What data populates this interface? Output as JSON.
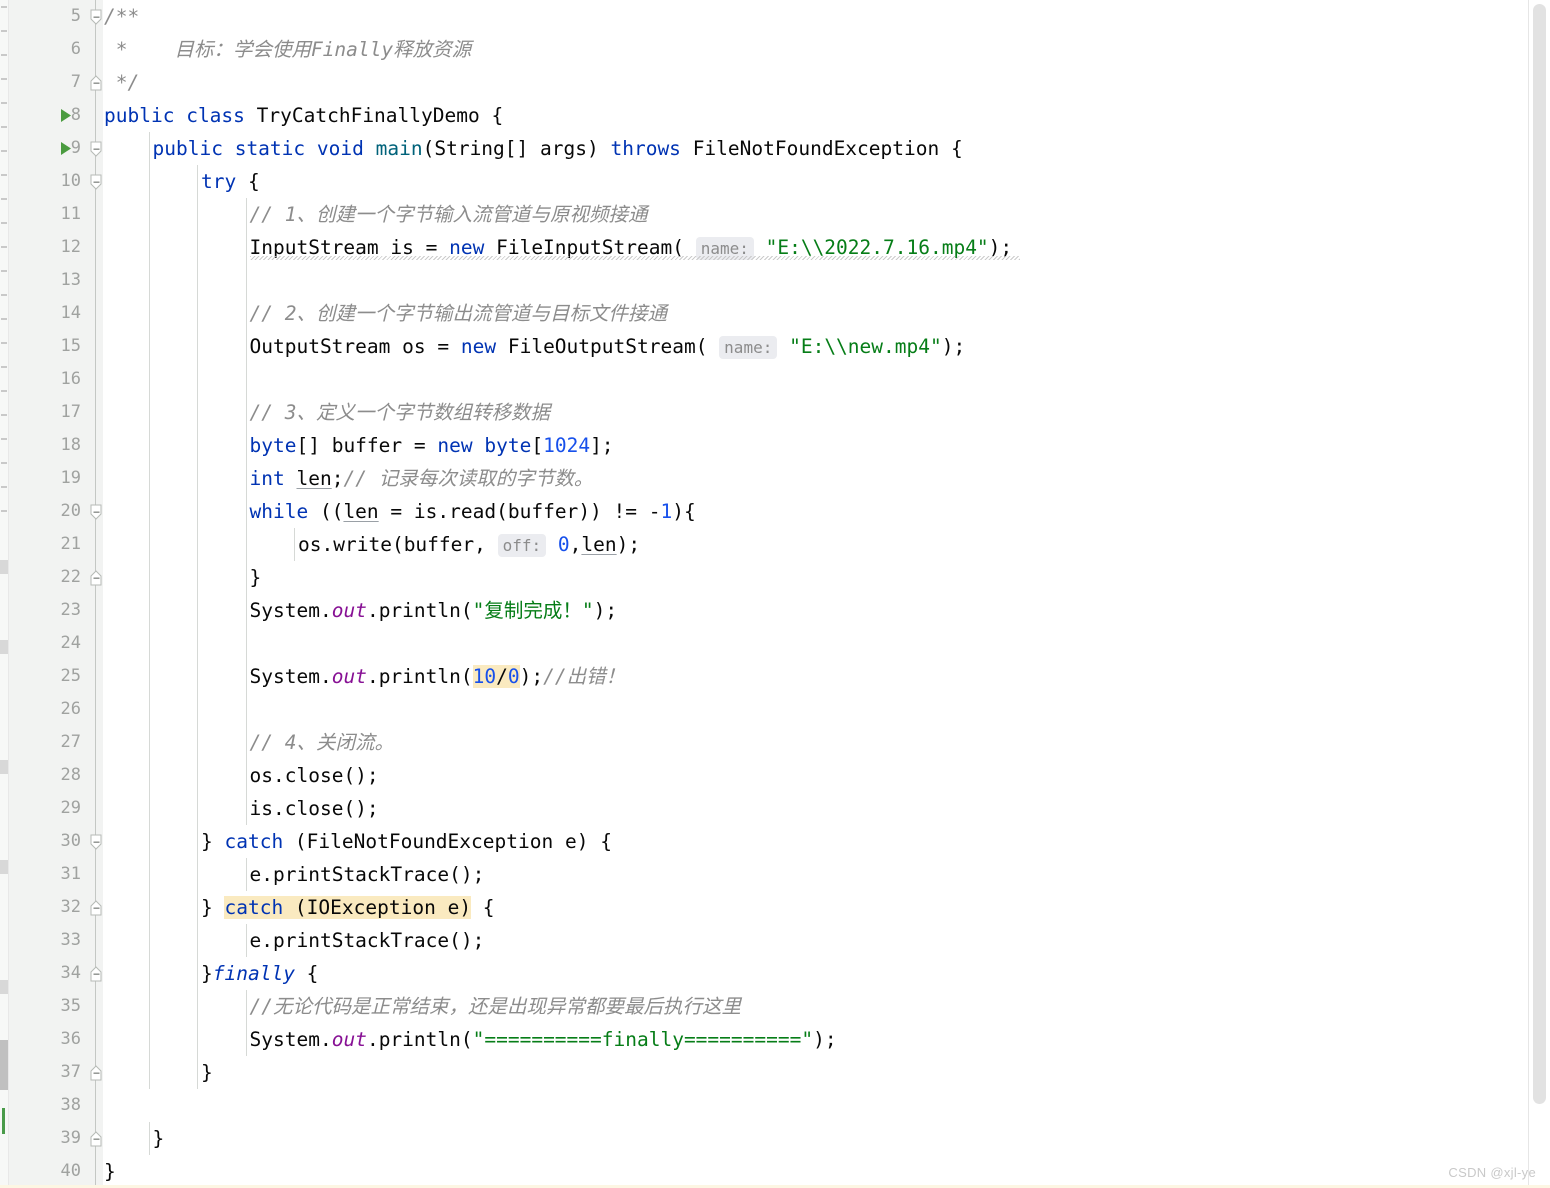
{
  "editor": {
    "app": "IntelliJ IDEA Java Editor",
    "language": "java",
    "watermark": "CSDN @xjl-ye",
    "colors": {
      "background": "#ffffff",
      "gutter_background": "#f2f3f2",
      "line_number": "#a0a2a0",
      "keyword": "#0033b3",
      "string": "#067d17",
      "comment": "#8c8c8c",
      "number": "#1750eb",
      "method": "#00627a",
      "static_field": "#871094",
      "highlight": "#faeac0",
      "hint_chip": "#ebecf0",
      "run_arrow": "#4a9b3f"
    },
    "first_line_number": 5,
    "last_line_number": 40
  },
  "gutter": {
    "line_numbers": [
      5,
      6,
      7,
      8,
      9,
      10,
      11,
      12,
      13,
      14,
      15,
      16,
      17,
      18,
      19,
      20,
      21,
      22,
      23,
      24,
      25,
      26,
      27,
      28,
      29,
      30,
      31,
      32,
      33,
      34,
      35,
      36,
      37,
      38,
      39,
      40
    ],
    "run_arrow_lines": [
      8,
      9
    ],
    "fold_lines": [
      5,
      7,
      9,
      10,
      20,
      22,
      30,
      32,
      34,
      37,
      39
    ],
    "fold_open_lines": [
      5,
      9,
      10,
      20,
      30
    ],
    "fold_close_lines": [
      7,
      22,
      32,
      34,
      37,
      39
    ]
  },
  "code": {
    "lines": [
      {
        "n": 5,
        "indent": 0,
        "text": "/**"
      },
      {
        "n": 6,
        "indent": 0,
        "text": " *    目标：学会使用Finally释放资源"
      },
      {
        "n": 7,
        "indent": 0,
        "text": " */"
      },
      {
        "n": 8,
        "indent": 0,
        "text": "public class TryCatchFinallyDemo {"
      },
      {
        "n": 9,
        "indent": 1,
        "text": "public static void main(String[] args) throws FileNotFoundException {"
      },
      {
        "n": 10,
        "indent": 2,
        "text": "try {"
      },
      {
        "n": 11,
        "indent": 3,
        "text": "// 1、创建一个字节输入流管道与原视频接通"
      },
      {
        "n": 12,
        "indent": 3,
        "text": "InputStream is = new FileInputStream( name: \"E:\\\\2022.7.16.mp4\");"
      },
      {
        "n": 13,
        "indent": 3,
        "text": ""
      },
      {
        "n": 14,
        "indent": 3,
        "text": "// 2、创建一个字节输出流管道与目标文件接通"
      },
      {
        "n": 15,
        "indent": 3,
        "text": "OutputStream os = new FileOutputStream( name: \"E:\\\\new.mp4\");"
      },
      {
        "n": 16,
        "indent": 3,
        "text": ""
      },
      {
        "n": 17,
        "indent": 3,
        "text": "// 3、定义一个字节数组转移数据"
      },
      {
        "n": 18,
        "indent": 3,
        "text": "byte[] buffer = new byte[1024];"
      },
      {
        "n": 19,
        "indent": 3,
        "text": "int len;// 记录每次读取的字节数。"
      },
      {
        "n": 20,
        "indent": 3,
        "text": "while ((len = is.read(buffer)) != -1){"
      },
      {
        "n": 21,
        "indent": 4,
        "text": "os.write(buffer, off: 0,len);"
      },
      {
        "n": 22,
        "indent": 3,
        "text": "}"
      },
      {
        "n": 23,
        "indent": 3,
        "text": "System.out.println(\"复制完成！\");"
      },
      {
        "n": 24,
        "indent": 3,
        "text": ""
      },
      {
        "n": 25,
        "indent": 3,
        "text": "System.out.println(10/0);//出错！"
      },
      {
        "n": 26,
        "indent": 3,
        "text": ""
      },
      {
        "n": 27,
        "indent": 3,
        "text": "// 4、关闭流。"
      },
      {
        "n": 28,
        "indent": 3,
        "text": "os.close();"
      },
      {
        "n": 29,
        "indent": 3,
        "text": "is.close();"
      },
      {
        "n": 30,
        "indent": 2,
        "text": "} catch (FileNotFoundException e) {"
      },
      {
        "n": 31,
        "indent": 3,
        "text": "e.printStackTrace();"
      },
      {
        "n": 32,
        "indent": 2,
        "text": "} catch (IOException e) {"
      },
      {
        "n": 33,
        "indent": 3,
        "text": "e.printStackTrace();"
      },
      {
        "n": 34,
        "indent": 2,
        "text": "}finally {"
      },
      {
        "n": 35,
        "indent": 3,
        "text": "//无论代码是正常结束，还是出现异常都要最后执行这里"
      },
      {
        "n": 36,
        "indent": 3,
        "text": "System.out.println(\"==========finally==========\");"
      },
      {
        "n": 37,
        "indent": 2,
        "text": "}"
      },
      {
        "n": 38,
        "indent": 0,
        "text": ""
      },
      {
        "n": 39,
        "indent": 1,
        "text": "}"
      },
      {
        "n": 40,
        "indent": 0,
        "text": "}"
      }
    ],
    "highlights": [
      {
        "line": 25,
        "token": "10/0",
        "color": "#faeac0"
      },
      {
        "line": 32,
        "token": "catch (IOException e)",
        "color": "#faeac0"
      }
    ],
    "parameter_hints": [
      {
        "line": 12,
        "label": "name:"
      },
      {
        "line": 15,
        "label": "name:"
      },
      {
        "line": 21,
        "label": "off:"
      }
    ],
    "class_name": "TryCatchFinallyDemo",
    "method_name": "main",
    "doc_comment": "目标：学会使用Finally释放资源",
    "strings": [
      "E:\\\\2022.7.16.mp4",
      "E:\\\\new.mp4",
      "复制完成！",
      "==========finally=========="
    ],
    "exceptions": [
      "FileNotFoundException",
      "IOException"
    ],
    "buffer_size": "1024",
    "division_expression": "10/0"
  }
}
